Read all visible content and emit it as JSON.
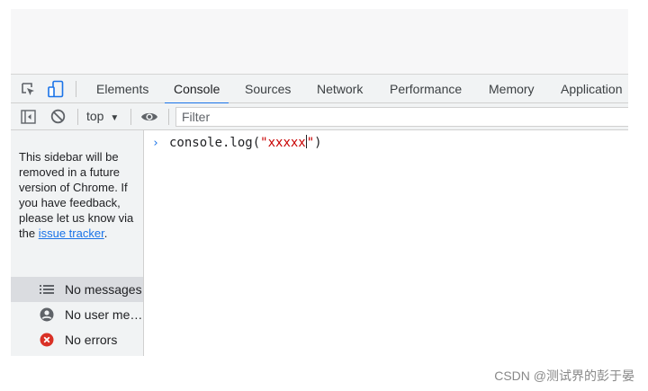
{
  "devtools": {
    "tabs": [
      {
        "label": "Elements"
      },
      {
        "label": "Console"
      },
      {
        "label": "Sources"
      },
      {
        "label": "Network"
      },
      {
        "label": "Performance"
      },
      {
        "label": "Memory"
      },
      {
        "label": "Application"
      }
    ],
    "active_tab": "Console",
    "accent_color": "#1a73e8"
  },
  "toolbar": {
    "context_label": "top",
    "filter_placeholder": "Filter"
  },
  "sidebar": {
    "notice_text": "This sidebar will be removed in a future version of Chrome. If you have feedback, please let us know via the",
    "notice_link": "issue tracker",
    "notice_suffix": ".",
    "items": [
      {
        "label": "No messages",
        "icon": "list-icon"
      },
      {
        "label": "No user me…",
        "icon": "user-icon"
      },
      {
        "label": "No errors",
        "icon": "error-icon",
        "color": "#d93025"
      }
    ]
  },
  "console": {
    "prompt": "›",
    "code_prefix": "console.log(",
    "string_before_caret": "\"xxxxx",
    "string_after_caret": "\"",
    "code_suffix": ")"
  },
  "watermark": "CSDN @测试界的彭于晏"
}
